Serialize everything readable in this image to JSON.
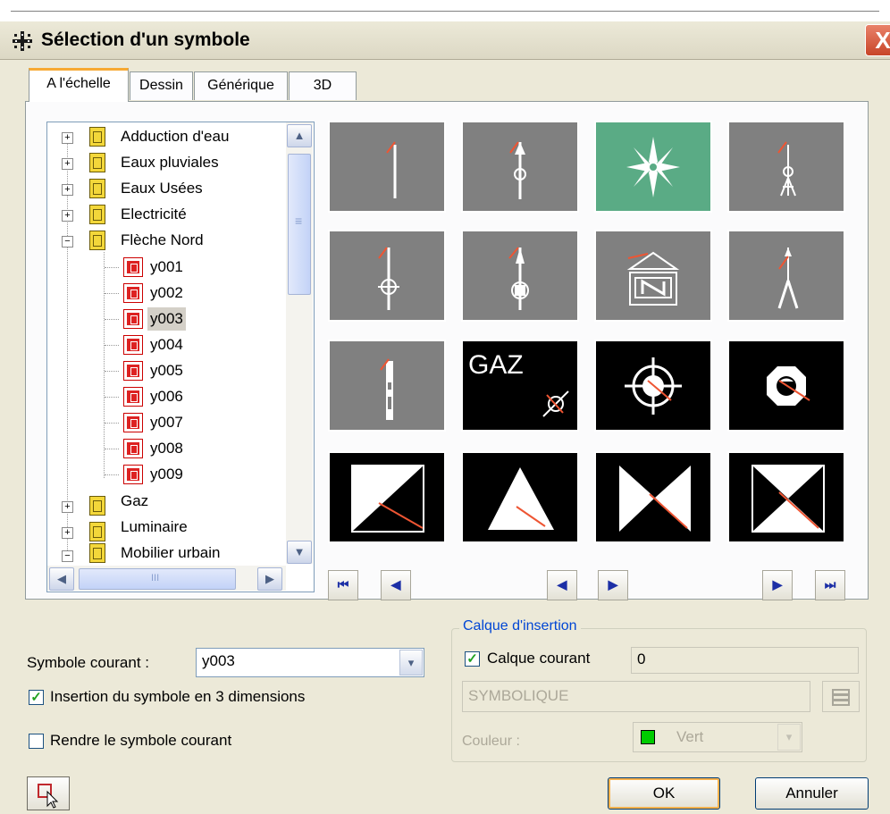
{
  "window": {
    "title": "Sélection d'un symbole",
    "close_glyph": "X"
  },
  "tabs": [
    {
      "label": "A l'échelle",
      "active": true
    },
    {
      "label": "Dessin",
      "active": false
    },
    {
      "label": "Générique",
      "active": false
    },
    {
      "label": "3D",
      "active": false
    }
  ],
  "tree": {
    "categories": [
      {
        "label": "Adduction d'eau",
        "expanded": false
      },
      {
        "label": "Eaux pluviales",
        "expanded": false
      },
      {
        "label": "Eaux Usées",
        "expanded": false
      },
      {
        "label": "Electricité",
        "expanded": false
      },
      {
        "label": "Flèche Nord",
        "expanded": true
      },
      {
        "label": "Gaz",
        "expanded": false
      },
      {
        "label": "Luminaire",
        "expanded": false
      },
      {
        "label": "Mobilier urbain",
        "expanded": true
      }
    ],
    "children": [
      "y001",
      "y002",
      "y003",
      "y004",
      "y005",
      "y006",
      "y007",
      "y008",
      "y009"
    ],
    "selected": "y003",
    "expand_glyph": "+",
    "collapse_glyph": "−"
  },
  "scrollbar": {
    "up": "▲",
    "down": "▼",
    "left": "◀",
    "right": "▶",
    "grip": "≡",
    "hgrip": "III"
  },
  "symbols_grid": {
    "selected_index": 2,
    "tiles": [
      {
        "bg": "#808080"
      },
      {
        "bg": "#808080"
      },
      {
        "bg": "#5aab85"
      },
      {
        "bg": "#808080"
      },
      {
        "bg": "#808080"
      },
      {
        "bg": "#808080"
      },
      {
        "bg": "#808080"
      },
      {
        "bg": "#808080"
      },
      {
        "bg": "#808080"
      },
      {
        "bg": "#000000",
        "text": "GAZ"
      },
      {
        "bg": "#000000"
      },
      {
        "bg": "#000000"
      },
      {
        "bg": "#000000"
      },
      {
        "bg": "#000000"
      },
      {
        "bg": "#000000"
      },
      {
        "bg": "#000000"
      }
    ]
  },
  "nav": {
    "first": "⏮",
    "prev_page": "◀",
    "prev": "◀",
    "next": "▶",
    "next_page": "▶",
    "last": "⏭"
  },
  "current_symbol": {
    "label": "Symbole courant :",
    "value": "y003",
    "dropdown_glyph": "▾"
  },
  "options": {
    "insert_3d": {
      "label": "Insertion du symbole en 3 dimensions",
      "checked": true
    },
    "make_current": {
      "label": "Rendre le symbole courant",
      "checked": false
    }
  },
  "layer_group": {
    "title": "Calque d'insertion",
    "current_layer": {
      "label": "Calque courant",
      "checked": true,
      "value": "0"
    },
    "layer_name": "SYMBOLIQUE",
    "color_label": "Couleur :",
    "color_value": "Vert",
    "color_swatch": "#00cc00",
    "dropdown_glyph": "▾",
    "checkmark": "✓"
  },
  "buttons": {
    "ok": "OK",
    "cancel": "Annuler"
  },
  "colors": {
    "accent": "#0046d5",
    "dialog_bg": "#ece9d8",
    "tab_highlight": "#f7a933"
  }
}
